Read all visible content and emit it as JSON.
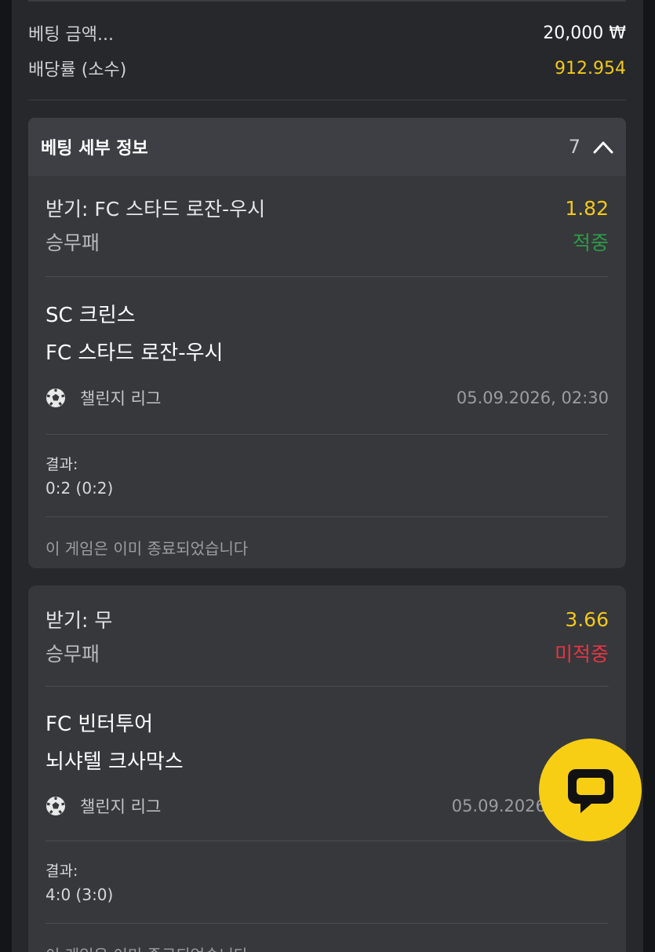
{
  "summary": {
    "stake_label": "베팅 금액...",
    "stake_value": "20,000 ₩",
    "odds_label": "배당률 (소수)",
    "odds_value": "912.954"
  },
  "details": {
    "title": "베팅 세부 정보",
    "count": "7"
  },
  "bets": [
    {
      "pick": "받기: FC 스타드 로잔-우시",
      "odds": "1.82",
      "market": "승무패",
      "outcome": "적중",
      "team_home": "SC 크린스",
      "team_away": "FC 스타드 로잔-우시",
      "league": "챌린지 리그",
      "datetime": "05.09.2026, 02:30",
      "result_label": "결과:",
      "result_value": "0:2 (0:2)",
      "status": "이 게임은 이미 종료되었습니다"
    },
    {
      "pick": "받기: 무",
      "odds": "3.66",
      "market": "승무패",
      "outcome": "미적중",
      "team_home": "FC 빈터투어",
      "team_away": "뇌샤텔 크사막스",
      "league": "챌린지 리그",
      "datetime": "05.09.2026",
      "result_label": "결과:",
      "result_value": "4:0 (3:0)",
      "status": "이 게임은 이미 종료되었습니다"
    }
  ],
  "colors": {
    "accent_yellow": "#f3c818",
    "won_green": "#2e9b46",
    "lost_red": "#e53542",
    "chat_button": "#f7ce14"
  },
  "icons": {
    "collapse": "chevron-up-icon",
    "sport": "soccer-ball-icon",
    "chat": "chat-bubble-icon"
  }
}
